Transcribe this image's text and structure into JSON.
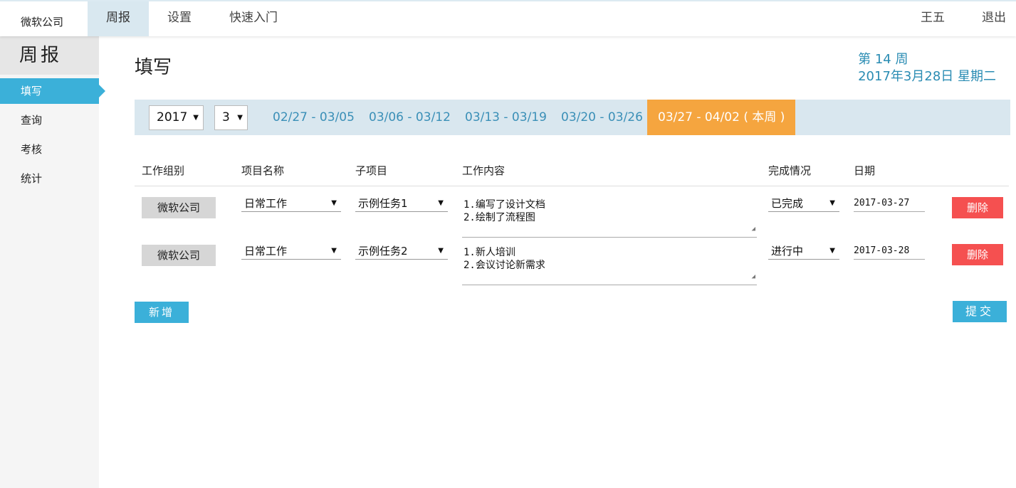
{
  "nav": {
    "brand": "微软公司",
    "items": [
      {
        "label": "周报",
        "active": true
      },
      {
        "label": "设置"
      },
      {
        "label": "快速入门"
      }
    ],
    "user": "王五",
    "logout": "退出"
  },
  "sidebar": {
    "title": "周报",
    "items": [
      {
        "label": "填写",
        "active": true
      },
      {
        "label": "查询"
      },
      {
        "label": "考核"
      },
      {
        "label": "统计"
      }
    ]
  },
  "page": {
    "title": "填写",
    "week_number": "第 14 周",
    "date": "2017年3月28日 星期二"
  },
  "week_selector": {
    "year": "2017",
    "month": "3",
    "ranges": [
      {
        "label": "02/27 - 03/05"
      },
      {
        "label": "03/06 - 03/12"
      },
      {
        "label": "03/13 - 03/19"
      },
      {
        "label": "03/20 - 03/26"
      },
      {
        "label": "03/27 - 04/02 ( 本周 )",
        "current": true
      }
    ]
  },
  "table": {
    "headers": [
      "工作组别",
      "项目名称",
      "子项目",
      "工作内容",
      "完成情况",
      "日期"
    ],
    "rows": [
      {
        "group": "微软公司",
        "project": "日常工作",
        "subproject": "示例任务1",
        "content_line1": "1.编写了设计文档",
        "content_line2": "2.绘制了流程图",
        "status": "已完成",
        "date": "2017-03-27",
        "delete": "删除"
      },
      {
        "group": "微软公司",
        "project": "日常工作",
        "subproject": "示例任务2",
        "content_line1": "1.新人培训",
        "content_line2": "2.会议讨论新需求",
        "status": "进行中",
        "date": "2017-03-28",
        "delete": "删除"
      }
    ]
  },
  "actions": {
    "add": "新增",
    "submit": "提交"
  },
  "colors": {
    "accent": "#3bb0d9",
    "current_week": "#f5a53f",
    "delete": "#f55050",
    "link": "#3a8fb7"
  }
}
